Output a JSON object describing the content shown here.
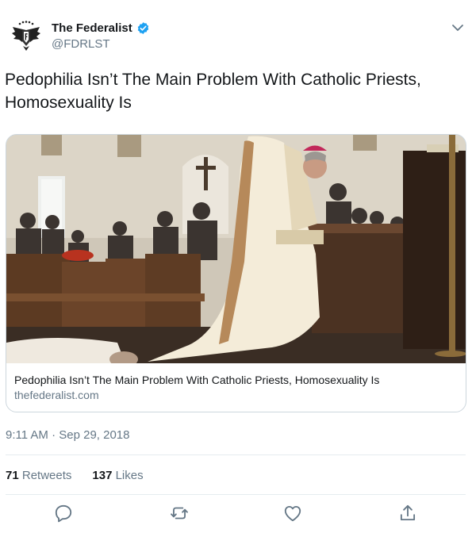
{
  "account": {
    "name": "The Federalist",
    "handle": "@FDRLST",
    "verified": true,
    "avatar_icon": "eagle-logo-icon"
  },
  "tweet": {
    "text": "Pedophilia Isn’t The Main Problem With Catholic Priests, Homosexuality Is"
  },
  "card": {
    "title": "Pedophilia Isn’t The Main Problem With Catholic Priests, Homosexuality Is",
    "domain": "thefederalist.com"
  },
  "meta": {
    "timestamp": "9:11 AM · Sep 29, 2018"
  },
  "stats": {
    "retweets_count": "71",
    "retweets_label": "Retweets",
    "likes_count": "137",
    "likes_label": "Likes"
  },
  "actions": [
    "reply-icon",
    "retweet-icon",
    "like-icon",
    "share-icon"
  ],
  "colors": {
    "verified_blue": "#1da1f2",
    "secondary_text": "#657786",
    "border": "#ccd6dd"
  }
}
